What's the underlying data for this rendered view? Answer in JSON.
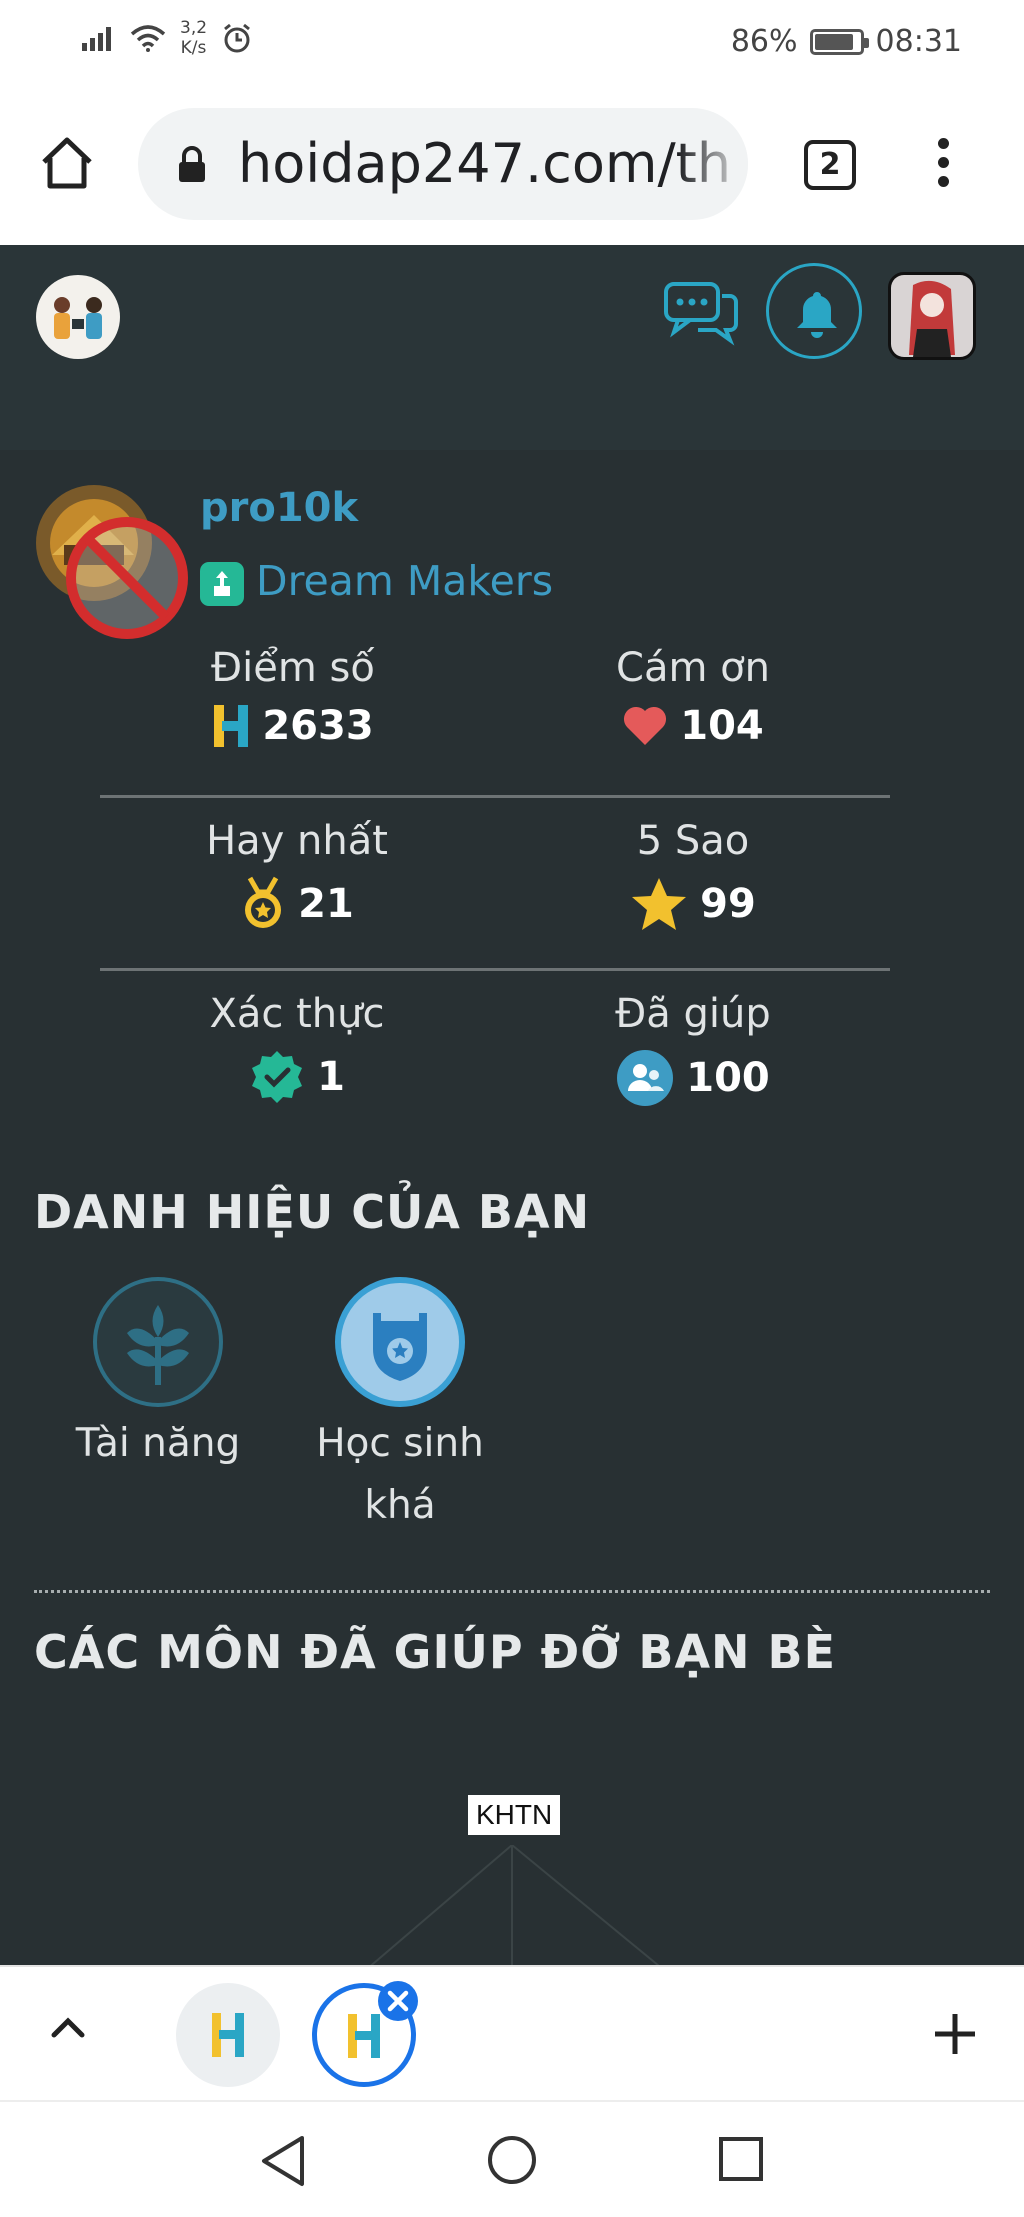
{
  "status_bar": {
    "speed_value": "3,2",
    "speed_unit": "K/s",
    "battery": "86%",
    "battery_level": 0.86,
    "time": "08:31"
  },
  "browser": {
    "url": "hoidap247.com/th",
    "tab_count": "2"
  },
  "profile": {
    "username": "pro10k",
    "team": "Dream Makers"
  },
  "stats": [
    {
      "label": "Điểm số",
      "value": "2633",
      "icon": "h-logo-icon"
    },
    {
      "label": "Cám ơn",
      "value": "104",
      "icon": "heart-icon"
    },
    {
      "label": "Hay nhất",
      "value": "21",
      "icon": "medal-icon"
    },
    {
      "label": "5 Sao",
      "value": "99",
      "icon": "star-icon"
    },
    {
      "label": "Xác thực",
      "value": "1",
      "icon": "verified-icon"
    },
    {
      "label": "Đã giúp",
      "value": "100",
      "icon": "people-icon"
    }
  ],
  "titles_section": {
    "heading": "DANH HIỆU CỦA BẠN",
    "badges": [
      {
        "label": "Tài năng",
        "icon": "leaf-icon"
      },
      {
        "label_line1": "Học sinh",
        "label_line2": "khá",
        "icon": "shield-star-icon"
      }
    ]
  },
  "subjects_section": {
    "heading": "CÁC MÔN ĐÃ GIÚP ĐỠ BẠN BÈ",
    "chart_root": "KHTN"
  },
  "colors": {
    "accent": "#3e9cc4",
    "background": "#283033",
    "team_badge": "#25b896"
  }
}
